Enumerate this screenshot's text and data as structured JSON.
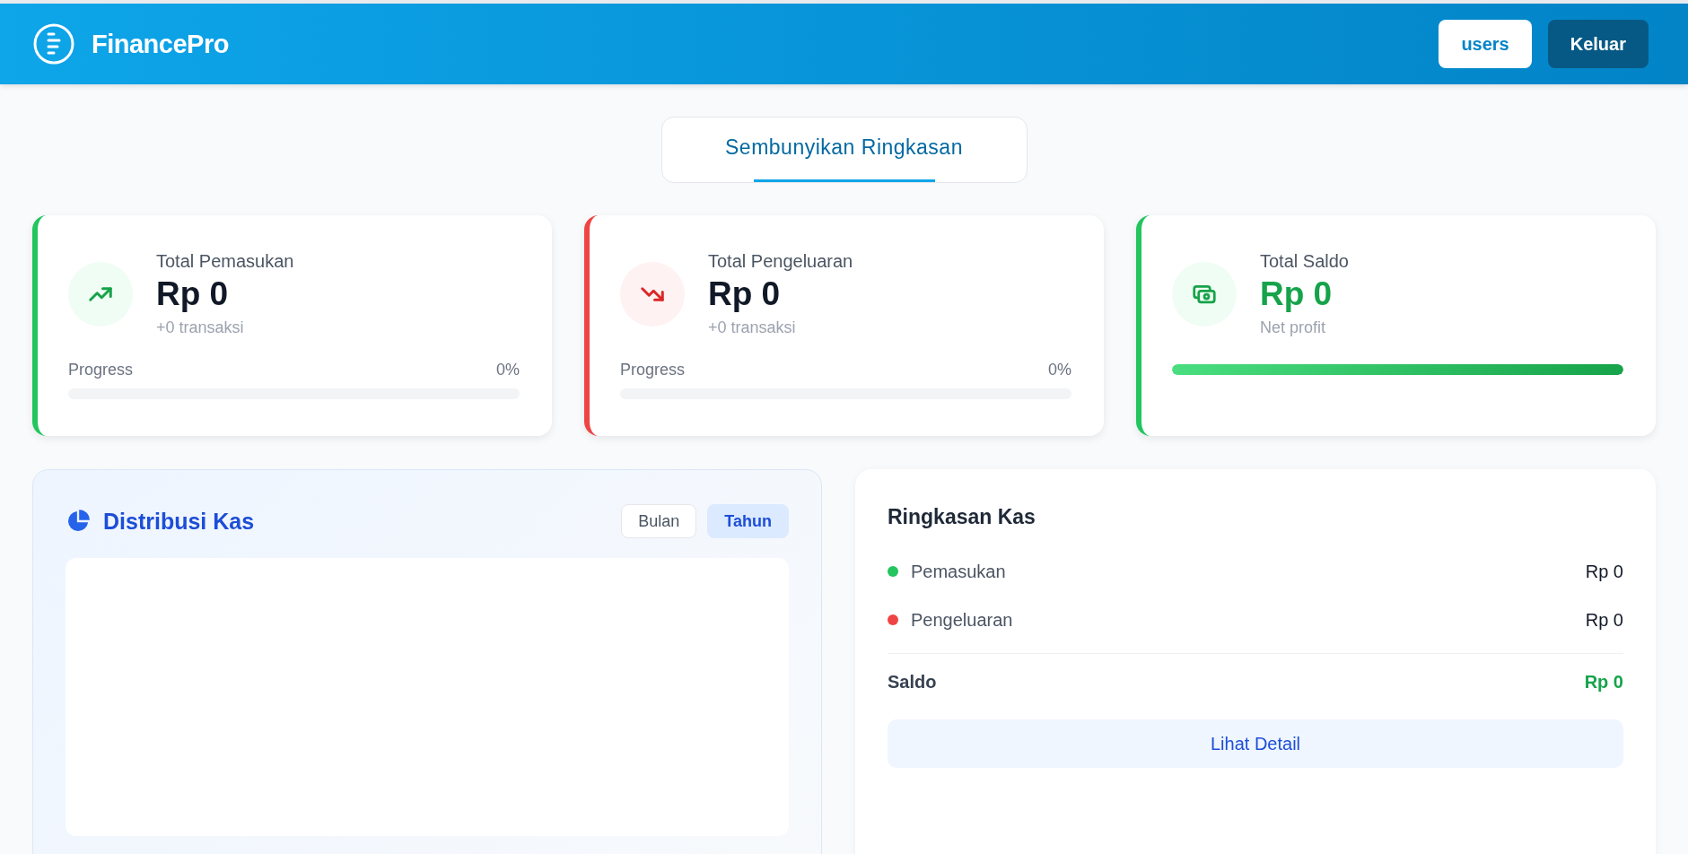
{
  "header": {
    "brand": "FinancePro",
    "buttons": [
      {
        "label": "users",
        "kind": "user"
      },
      {
        "label": "Keluar",
        "kind": "logout"
      }
    ]
  },
  "summary_toggle": {
    "label": "Sembunyikan Ringkasan",
    "selected": true
  },
  "cards": [
    {
      "kind": "income",
      "color": "#22c55e",
      "title": "Total Pemasukan",
      "value": "Rp 0",
      "note": "+0 transaksi",
      "progress_label": "Progress",
      "progress_reading": "0%",
      "level": 0
    },
    {
      "kind": "expense",
      "color": "#ef4444",
      "title": "Total Pengeluaran",
      "value": "Rp 0",
      "note": "+0 transaksi",
      "progress_label": "Progress",
      "progress_reading": "0%",
      "level": 0
    },
    {
      "kind": "balance",
      "color": "#22c55e",
      "title": "Total Saldo",
      "value": "Rp 0",
      "note": "Net profit",
      "level": 1
    }
  ],
  "distribution": {
    "title": "Distribusi Kas",
    "periods": [
      {
        "label": "Bulan",
        "selected": false
      },
      {
        "label": "Tahun",
        "selected": true
      }
    ]
  },
  "cash_summary": {
    "title": "Ringkasan Kas",
    "rows": [
      {
        "label": "Pemasukan",
        "value": "Rp 0",
        "color": "#22c55e"
      },
      {
        "label": "Pengeluaran",
        "value": "Rp 0",
        "color": "#ef4444"
      }
    ],
    "total_label": "Saldo",
    "total_value": "Rp 0",
    "button": "Lihat Detail"
  }
}
